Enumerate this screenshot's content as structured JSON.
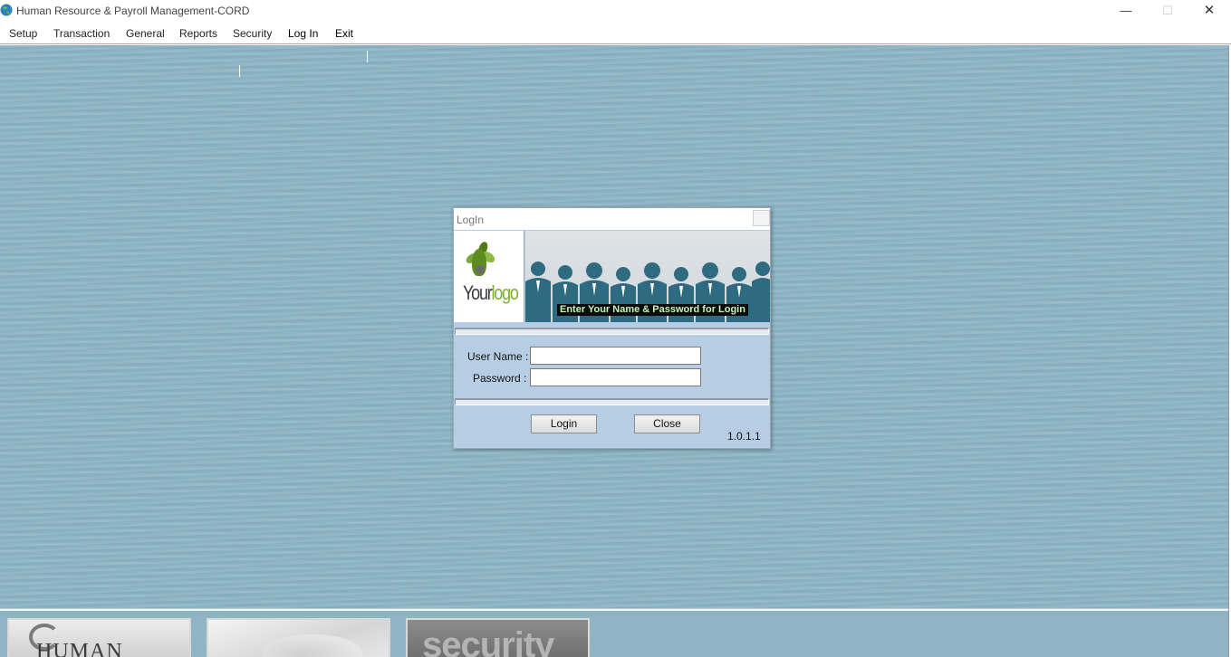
{
  "window": {
    "title": "Human Resource & Payroll Management-CORD",
    "minimize_glyph": "—",
    "maximize_glyph": "☐",
    "close_glyph": "✕"
  },
  "menu": {
    "items": [
      {
        "label": "Setup"
      },
      {
        "label": "Transaction"
      },
      {
        "label": "General"
      },
      {
        "label": "Reports"
      },
      {
        "label": "Security"
      },
      {
        "label": "Log In"
      },
      {
        "label": "Exit"
      }
    ]
  },
  "login_dialog": {
    "title": "LogIn",
    "logo": {
      "part1": "Your",
      "part2": "logo"
    },
    "banner_caption": "Enter Your Name & Password for Login",
    "username_label": "User Name :",
    "username_value": "",
    "password_label": "Password :",
    "password_value": "",
    "login_button": "Login",
    "close_button": "Close",
    "version": "1.0.1.1"
  },
  "bottom_tiles": {
    "hr_text": "HUMAN",
    "security_text": "security"
  },
  "colors": {
    "desktop_bg": "#8db6c6",
    "dialog_bg": "#b7cde3",
    "banner_people": "#2f6b80",
    "caption_text": "#c6f6b5",
    "logo_green": "#7fae36"
  },
  "icons": [
    "app-globe-icon",
    "minimize-icon",
    "maximize-icon",
    "close-icon",
    "dialog-close-icon",
    "logo-plant-icon"
  ]
}
